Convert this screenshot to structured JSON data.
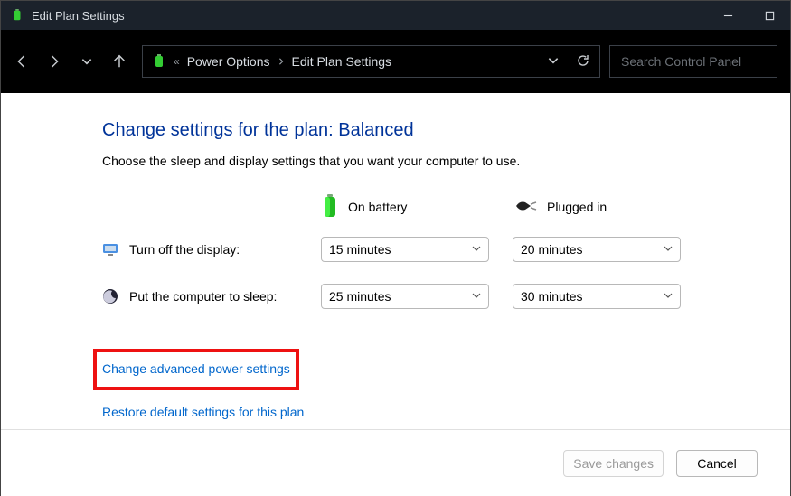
{
  "window": {
    "title": "Edit Plan Settings"
  },
  "breadcrumb": {
    "items": [
      "Power Options",
      "Edit Plan Settings"
    ]
  },
  "search": {
    "placeholder": "Search Control Panel"
  },
  "page": {
    "title": "Change settings for the plan: Balanced",
    "description": "Choose the sleep and display settings that you want your computer to use."
  },
  "columns": {
    "battery": "On battery",
    "plugged": "Plugged in"
  },
  "rows": {
    "display": {
      "label": "Turn off the display:",
      "battery_value": "15 minutes",
      "plugged_value": "20 minutes"
    },
    "sleep": {
      "label": "Put the computer to sleep:",
      "battery_value": "25 minutes",
      "plugged_value": "30 minutes"
    }
  },
  "links": {
    "advanced": "Change advanced power settings",
    "restore": "Restore default settings for this plan"
  },
  "footer": {
    "save": "Save changes",
    "cancel": "Cancel"
  }
}
